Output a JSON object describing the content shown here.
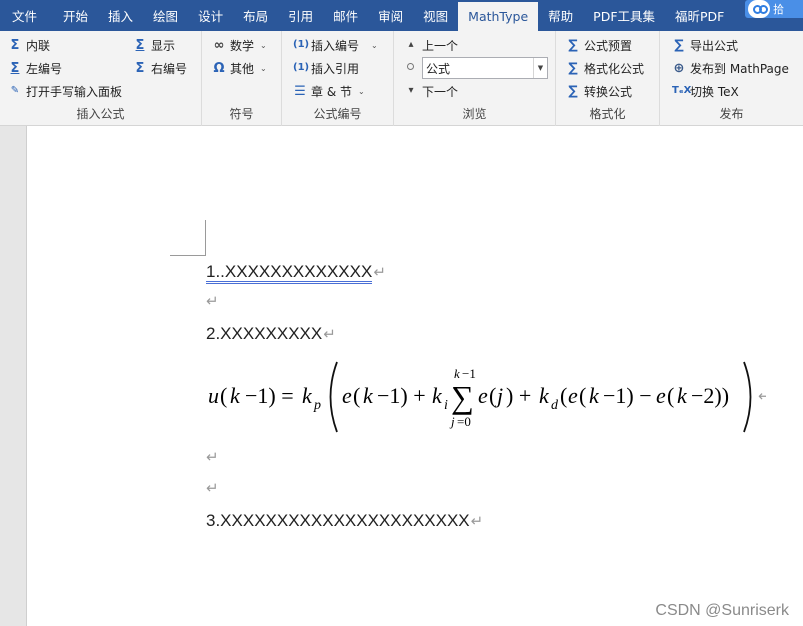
{
  "menubar": {
    "tabs": [
      "文件",
      "开始",
      "插入",
      "绘图",
      "设计",
      "布局",
      "引用",
      "邮件",
      "审阅",
      "视图",
      "MathType",
      "帮助",
      "PDF工具集",
      "福昕PDF"
    ],
    "active_tab": "MathType",
    "badge_text": "拾"
  },
  "ribbon": {
    "insert_formula": {
      "label": "插入公式",
      "inline": "内联",
      "left_numbered": "左编号",
      "handwriting": "打开手写输入面板",
      "display": "显示",
      "right_numbered": "右编号"
    },
    "symbols": {
      "label": "符号",
      "math": "数学",
      "other": "其他"
    },
    "formula_number": {
      "label": "公式编号",
      "insert_number": "插入编号",
      "insert_reference": "插入引用",
      "chapter_section": "章 & 节",
      "num_icon": "(1)"
    },
    "browse": {
      "label": "浏览",
      "prev": "上一个",
      "next": "下一个",
      "combo_value": "公式"
    },
    "format": {
      "label": "格式化",
      "preset": "公式预置",
      "format_formula": "格式化公式",
      "convert": "转换公式"
    },
    "publish": {
      "label": "发布",
      "export": "导出公式",
      "publish_mathpage": "发布到 MathPage",
      "toggle_tex": "切换 TeX"
    }
  },
  "document": {
    "line1": "1..XXXXXXXXXXXXX",
    "line2": "2.XXXXXXXXX",
    "line3": "3.XXXXXXXXXXXXXXXXXXXXXX",
    "para_mark": "↵"
  },
  "watermark": "CSDN @Sunriserk"
}
